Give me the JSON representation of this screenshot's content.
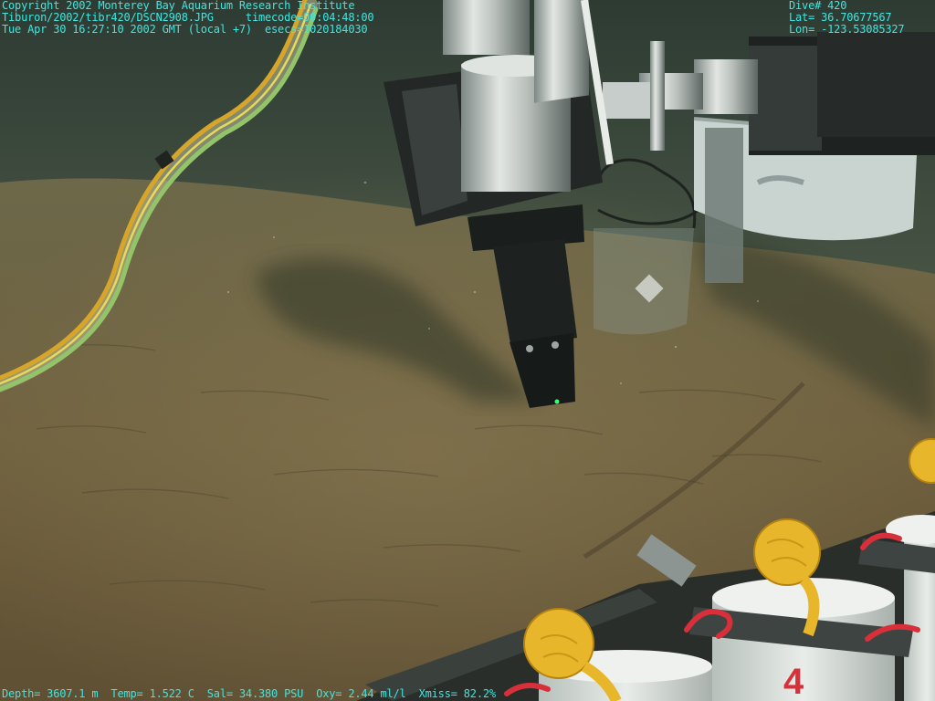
{
  "overlay": {
    "top_left": {
      "line1": "Copyright 2002 Monterey Bay Aquarium Research Institute",
      "line2": "Tiburon/2002/tibr420/DSCN2908.JPG     timecode=00:04:48:00",
      "line3": "Tue Apr 30 16:27:10 2002 GMT (local +7)  esecs=1020184030"
    },
    "top_right": {
      "dive": "Dive# 420",
      "lat": "Lat= 36.70677567",
      "lon": "Lon= -123.53085327"
    },
    "bottom": {
      "sensors": "Depth= 3607.1 m  Temp= 1.522 C  Sal= 34.380 PSU  Oxy= 2.44 ml/l  Xmiss= 82.2%"
    }
  },
  "scene": {
    "marker_number": "4"
  },
  "colors": {
    "overlay_text": "#3fe7e0",
    "water": "#3b4a3f",
    "sediment": "#6e6444",
    "rope": "#e8b62a",
    "marker": "#d8303a"
  }
}
